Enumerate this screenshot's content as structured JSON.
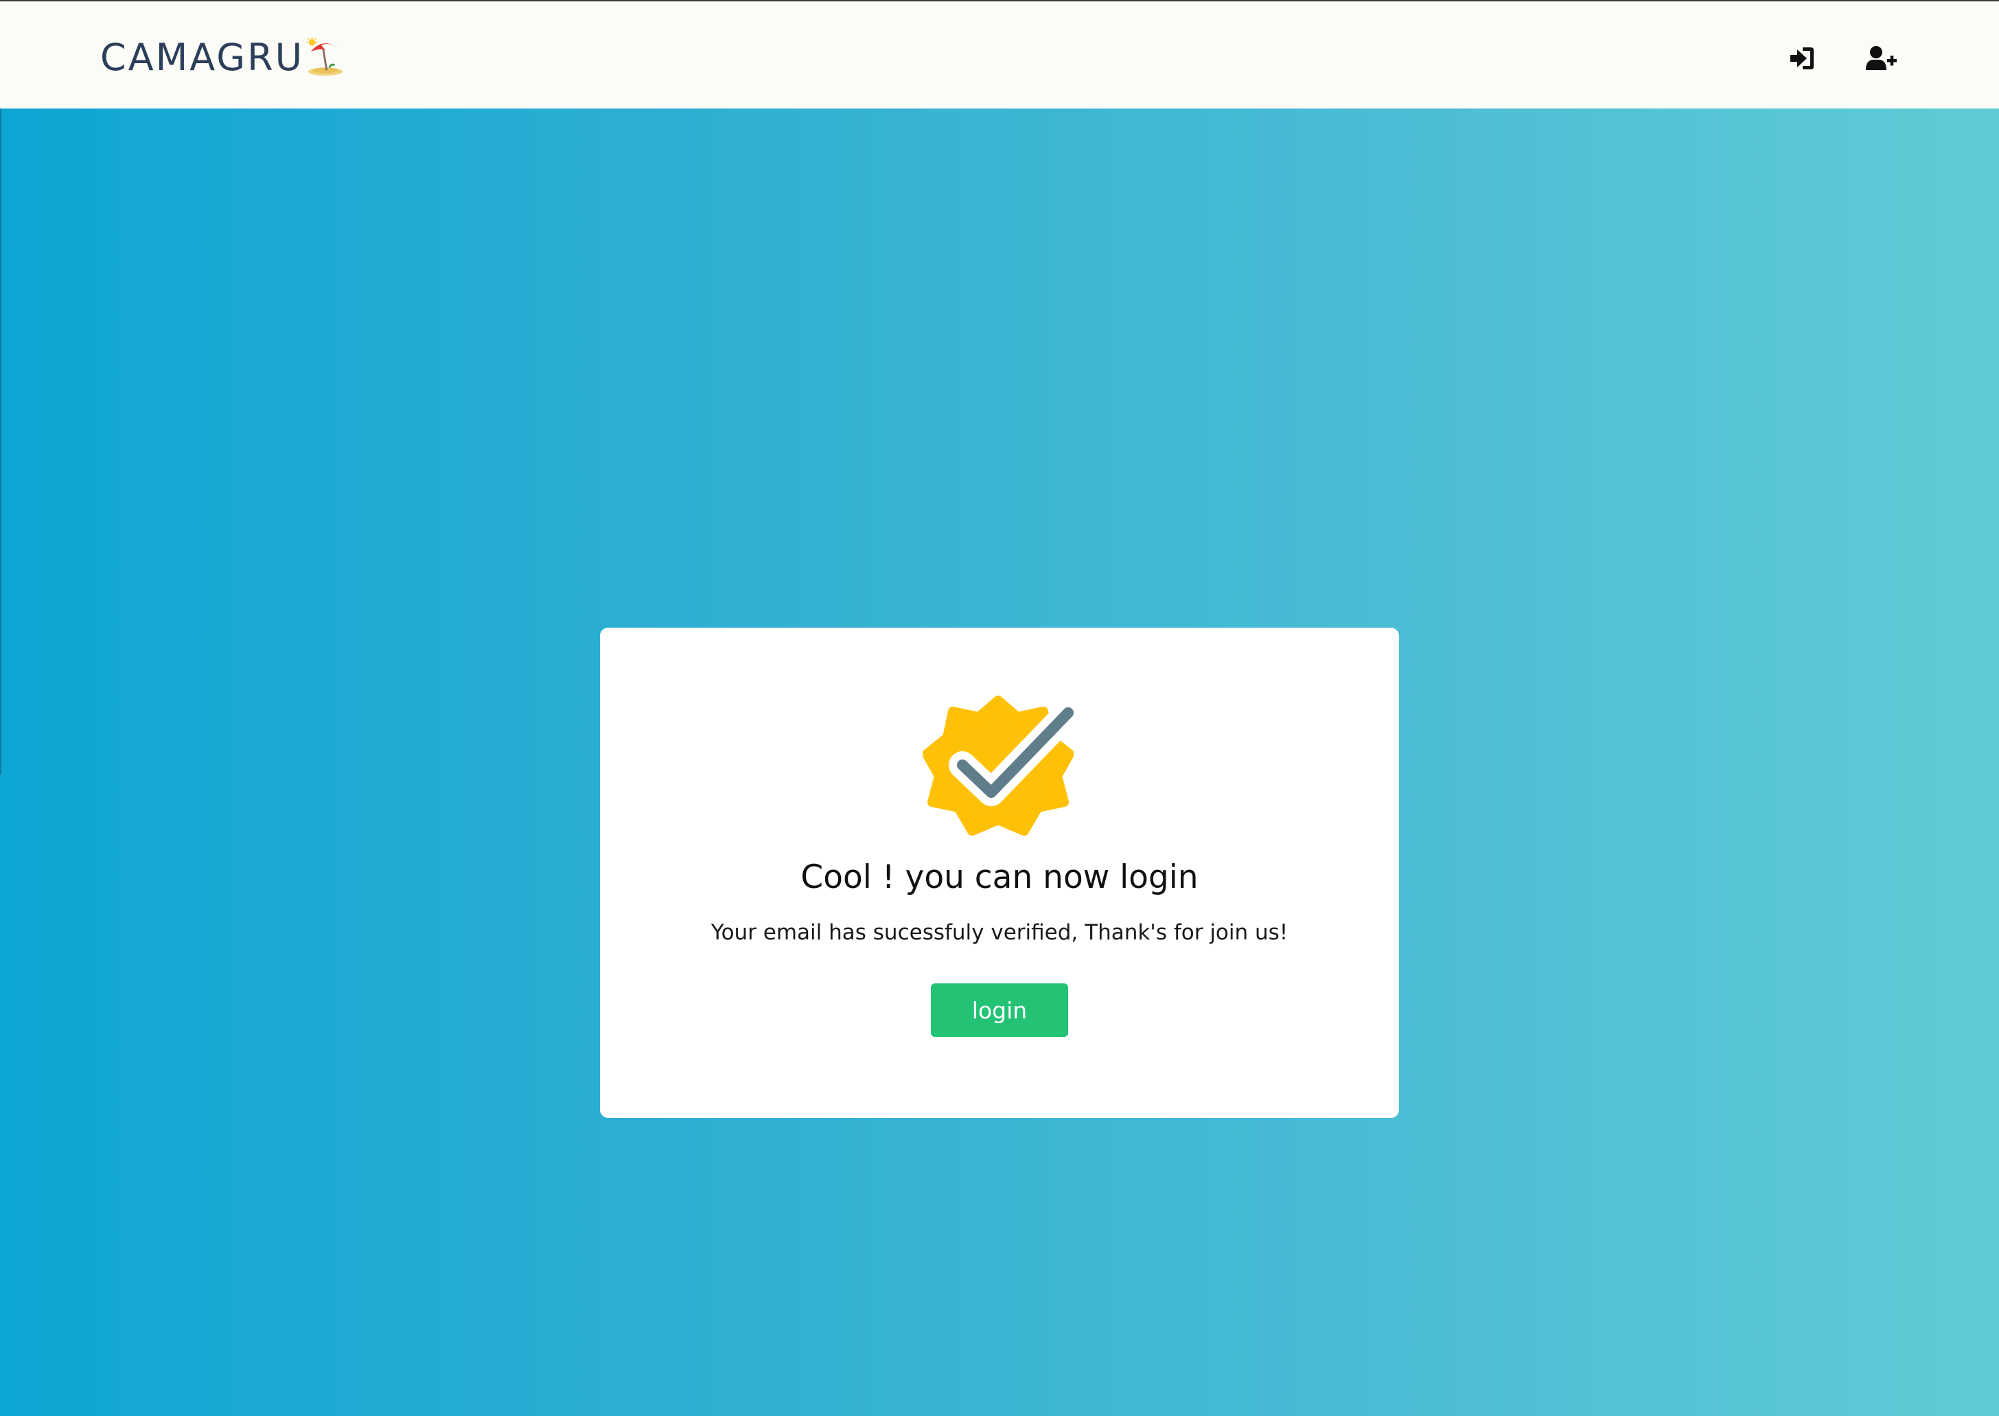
{
  "navbar": {
    "brand": "CAMAGRU",
    "brand_icon": "beach-umbrella-island-icon",
    "login_icon": "sign-in-icon",
    "signup_icon": "user-plus-icon"
  },
  "card": {
    "badge_icon": "verified-badge-check-icon",
    "title": "Cool ! you can now login",
    "message": "Your email has sucessfuly verified, Thank's for join us!",
    "login_label": "login"
  },
  "colors": {
    "navbar_bg": "#fbfcf7",
    "brand_text": "#2c3e5a",
    "gradient_start": "#0ea6d3",
    "gradient_end": "#5fcbd5",
    "button_green": "#23c275",
    "badge_yellow": "#ffc107",
    "check_gray": "#607d8b"
  }
}
